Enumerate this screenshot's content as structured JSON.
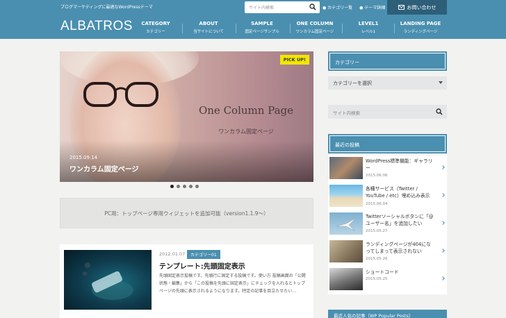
{
  "header": {
    "tagline": "ブログマーケティングに最適なWordPressテーマ",
    "search_placeholder": "サイト内検索",
    "links": [
      "カテゴリー覧",
      "テーマ詳細"
    ],
    "contact_label": "お問い合わせ",
    "logo": "ALBATROS",
    "nav": [
      {
        "en": "CATEGORY",
        "ja": "カテゴリー"
      },
      {
        "en": "ABOUT",
        "ja": "当サイトについて"
      },
      {
        "en": "SAMPLE",
        "ja": "固定ページサンプル"
      },
      {
        "en": "ONE COLUMN",
        "ja": "ワンカラム固定ページ"
      },
      {
        "en": "LEVEL1",
        "ja": "レベル1"
      },
      {
        "en": "LANDING PAGE",
        "ja": "ランディングページ"
      }
    ],
    "colors": {
      "primary": "#4a8fb0",
      "dark": "#2d5f79"
    }
  },
  "hero": {
    "badge": "PICK UP!",
    "image_title_en": "One Column Page",
    "image_title_ja": "ワンカラム固定ページ",
    "date": "2015.09.14",
    "caption": "ワンカラム固定ページ",
    "slides": 5,
    "active_slide": 1
  },
  "notice": {
    "text": "PC用：トップページ専用ウィジェットを追加可能（version1.1.9〜）"
  },
  "post": {
    "date": "2012.01.07",
    "category": "カテゴリー01",
    "title": "テンプレート:先頭固定表示",
    "excerpt": "先頭固定表示投稿です。先頭行に固定する投稿です。使い方 投稿画面の「公開状態・編集」から「この投稿を先頭に固定表示」にチェックを入れるとトップページの先頭に表示されるようになります。特定の記事を目立たせたい…"
  },
  "sidebar": {
    "category_heading": "カテゴリー",
    "category_select": "カテゴリーを選択",
    "search_placeholder": "サイト内検索",
    "recent_heading": "最近の投稿",
    "recent": [
      {
        "title": "WordPress標準機能：ギャラリー",
        "date": "2015.06.06"
      },
      {
        "title": "各種サービス（Twitter / YouTube / etc）埋め込み表示",
        "date": "2015.06.04"
      },
      {
        "title": "Twitterソーシャルボタンに「@ユーザー名」を追加したい",
        "date": "2015.05.27"
      },
      {
        "title": "ランディングページが404になってしまって表示されない",
        "date": "2015.05.26"
      },
      {
        "title": "ショートコード",
        "date": "2015.05.25"
      }
    ],
    "popular_heading": "最近人気の記事（WP Popular Posts）"
  }
}
